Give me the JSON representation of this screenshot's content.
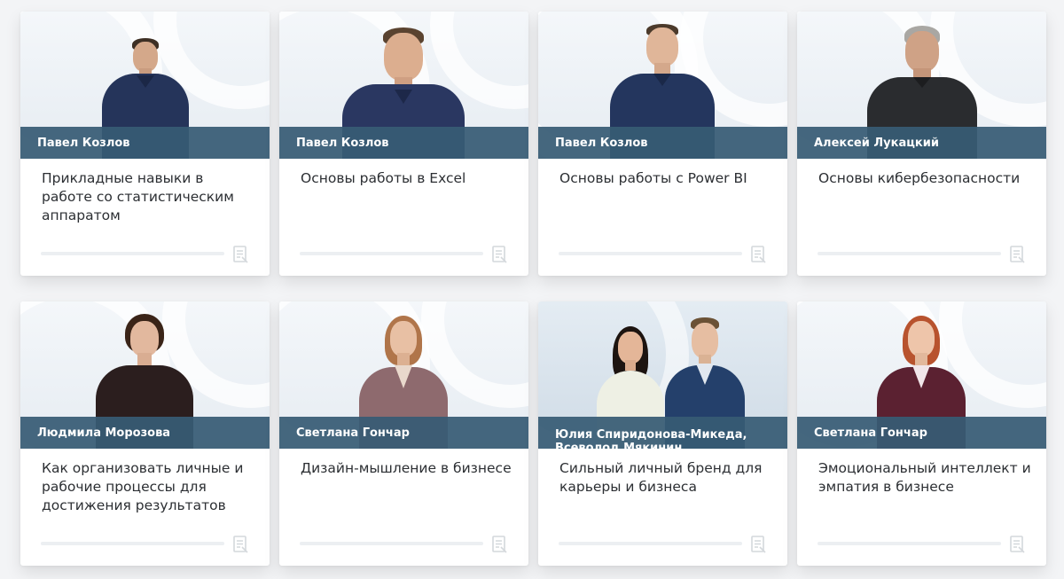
{
  "courses": [
    {
      "author": "Павел Козлов",
      "title": "Прикладные навыки в работе со статистическим аппаратом"
    },
    {
      "author": "Павел Козлов",
      "title": "Основы работы в Excel"
    },
    {
      "author": "Павел Козлов",
      "title": "Основы работы с Power BI"
    },
    {
      "author": "Алексей Лукацкий",
      "title": "Основы кибербезопасности"
    },
    {
      "author": "Людмила Морозова",
      "title": "Как организовать личные и рабочие процессы для достижения результатов"
    },
    {
      "author": "Светлана Гончар",
      "title": "Дизайн-мышление в бизнесе"
    },
    {
      "author": "Юлия Спиридонова-Микеда,",
      "author_line2": "Всеволод Мякинин",
      "title": "Сильный личный бренд для карьеры и бизнеса"
    },
    {
      "author": "Светлана Гончар",
      "title": "Эмоциональный интеллект и эмпатия в бизнесе"
    }
  ],
  "colors": {
    "name_bar": "#375b74",
    "title_text": "#2c2f33",
    "progress_track": "#eceff2",
    "icon": "#d4d8dc"
  },
  "icons": {
    "lesson": "document-icon"
  }
}
